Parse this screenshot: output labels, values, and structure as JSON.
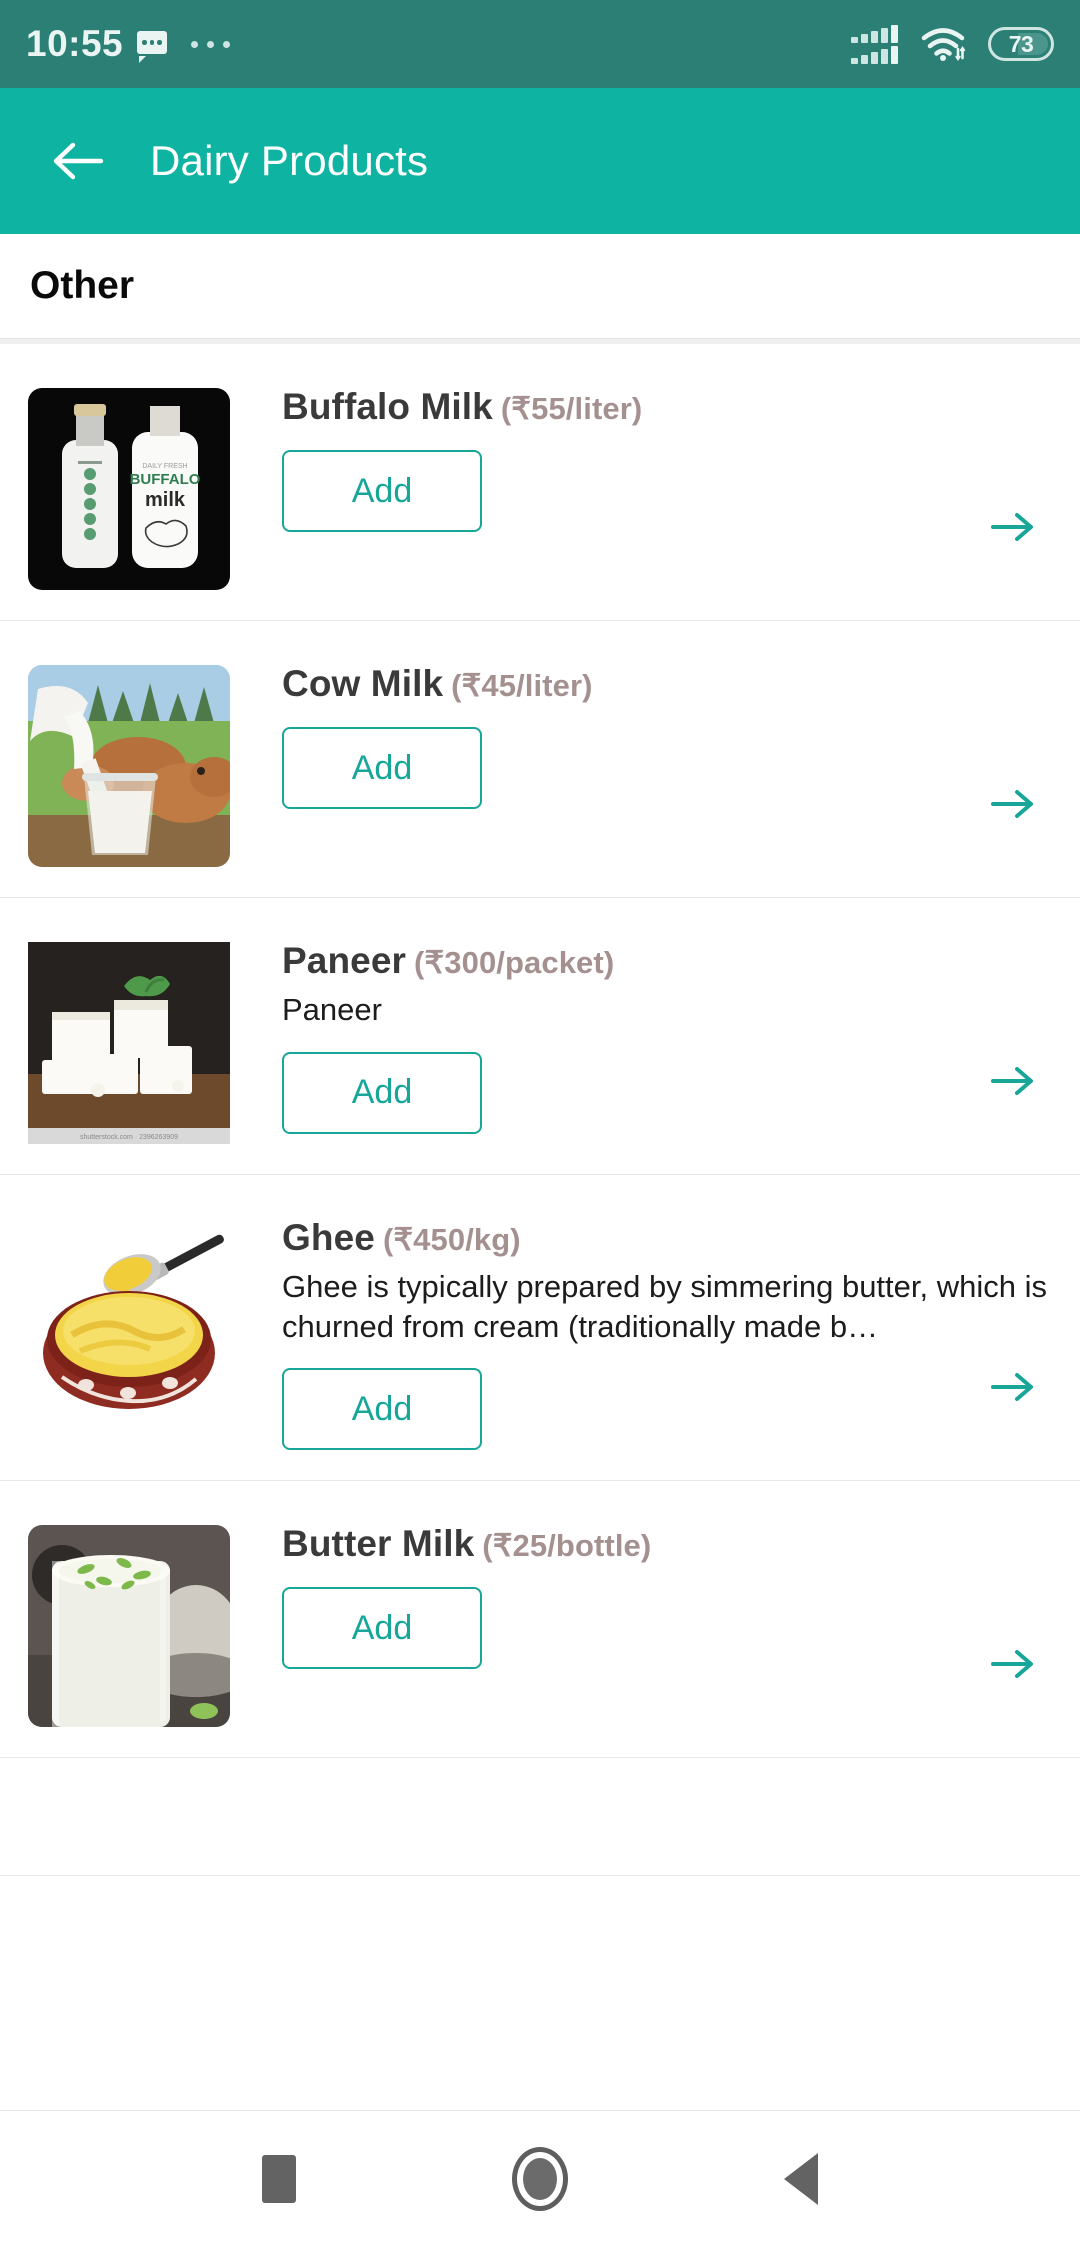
{
  "status_bar": {
    "time": "10:55",
    "message_icon": "message-bubble-icon",
    "overflow_icon": "more-dots-icon",
    "signal_icon": "dual-signal-bars-icon",
    "wifi_icon": "wifi-icon",
    "battery_level": "73",
    "background_color": "#2b7f74"
  },
  "app_bar": {
    "back_icon": "back-arrow-icon",
    "title": "Dairy Products",
    "background_color": "#0fb3a1"
  },
  "section": {
    "label": "Other"
  },
  "products": [
    {
      "name": "Buffalo Milk",
      "price": "(₹55/liter)",
      "description": "",
      "add_label": "Add",
      "thumb_name": "buffalo-milk-thumbnail",
      "go_icon": "arrow-right-icon"
    },
    {
      "name": "Cow Milk",
      "price": "(₹45/liter)",
      "description": "",
      "add_label": "Add",
      "thumb_name": "cow-milk-thumbnail",
      "go_icon": "arrow-right-icon"
    },
    {
      "name": "Paneer",
      "price": "(₹300/packet)",
      "description": "Paneer",
      "add_label": "Add",
      "thumb_name": "paneer-thumbnail",
      "go_icon": "arrow-right-icon"
    },
    {
      "name": "Ghee",
      "price": "(₹450/kg)",
      "description": "Ghee is typically prepared by simmering butter, which is churned from cream (traditionally made b…",
      "add_label": "Add",
      "thumb_name": "ghee-thumbnail",
      "go_icon": "arrow-right-icon"
    },
    {
      "name": "Butter Milk",
      "price": "(₹25/bottle)",
      "description": "",
      "add_label": "Add",
      "thumb_name": "butter-milk-thumbnail",
      "go_icon": "arrow-right-icon"
    }
  ],
  "nav_bar": {
    "recents_icon": "recents-square-icon",
    "home_icon": "home-circle-icon",
    "back_icon": "back-triangle-icon"
  },
  "colors": {
    "accent": "#17a698",
    "app_bar": "#0fb3a1",
    "status_bar": "#2b7f74",
    "price_text": "#a4908f"
  }
}
